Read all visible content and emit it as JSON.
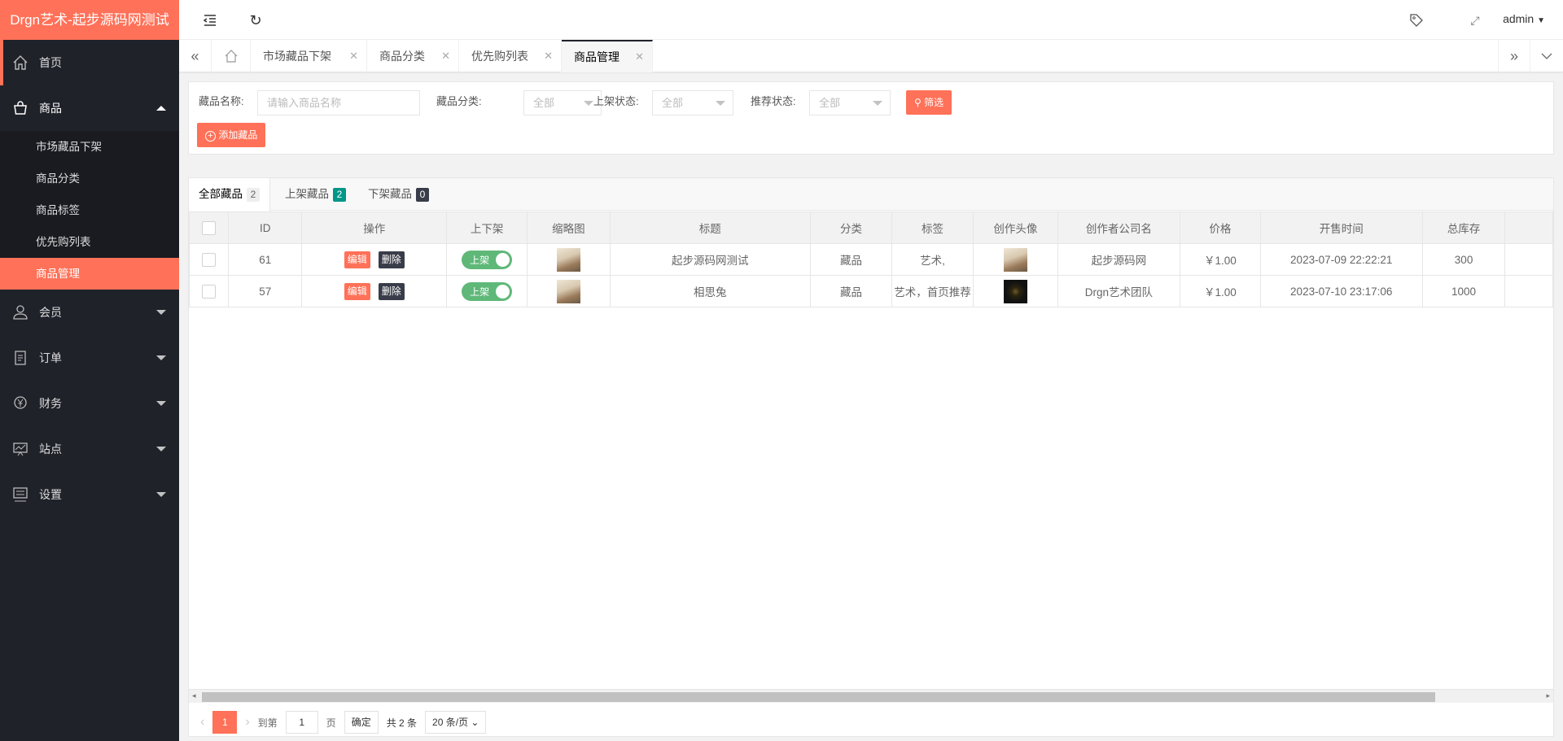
{
  "app": {
    "title": "Drgn艺术-起步源码网测试",
    "user": "admin"
  },
  "sidebar": {
    "items": [
      {
        "label": "首页",
        "icon": "home-icon"
      },
      {
        "label": "商品",
        "icon": "basket-icon",
        "open": true,
        "children": [
          {
            "label": "市场藏品下架"
          },
          {
            "label": "商品分类"
          },
          {
            "label": "商品标签"
          },
          {
            "label": "优先购列表"
          },
          {
            "label": "商品管理",
            "active": true
          }
        ]
      },
      {
        "label": "会员",
        "icon": "user-icon"
      },
      {
        "label": "订单",
        "icon": "order-icon"
      },
      {
        "label": "财务",
        "icon": "finance-icon"
      },
      {
        "label": "站点",
        "icon": "site-icon"
      },
      {
        "label": "设置",
        "icon": "settings-icon"
      }
    ]
  },
  "tabs": [
    {
      "label": "市场藏品下架"
    },
    {
      "label": "商品分类"
    },
    {
      "label": "优先购列表"
    },
    {
      "label": "商品管理",
      "active": true
    }
  ],
  "filter": {
    "name_label": "藏品名称:",
    "name_placeholder": "请输入商品名称",
    "category_label": "藏品分类:",
    "category_value": "全部",
    "shelf_label": "上架状态:",
    "shelf_value": "全部",
    "recommend_label": "推荐状态:",
    "recommend_value": "全部",
    "search_button": "筛选",
    "add_button": "添加藏品"
  },
  "list_tabs": [
    {
      "label": "全部藏品",
      "count": "2"
    },
    {
      "label": "上架藏品",
      "count": "2"
    },
    {
      "label": "下架藏品",
      "count": "0"
    }
  ],
  "table": {
    "columns": [
      "ID",
      "操作",
      "上下架",
      "缩略图",
      "标题",
      "分类",
      "标签",
      "创作头像",
      "创作者公司名",
      "价格",
      "开售时间",
      "总库存"
    ],
    "edit_label": "编辑",
    "delete_label": "删除",
    "toggle_label": "上架",
    "rows": [
      {
        "id": "61",
        "title": "起步源码网测试",
        "category": "藏品",
        "tags": "艺术,",
        "company": "起步源码网",
        "price": "￥1.00",
        "sale_time": "2023-07-09 22:22:21",
        "stock": "300"
      },
      {
        "id": "57",
        "title": "相思兔",
        "category": "藏品",
        "tags": "艺术，首页推荐",
        "company": "Drgn艺术团队",
        "price": "￥1.00",
        "sale_time": "2023-07-10 23:17:06",
        "stock": "1000"
      }
    ]
  },
  "pagination": {
    "current": "1",
    "goto_label": "到第",
    "goto_value": "1",
    "page_label": "页",
    "confirm": "确定",
    "total": "共 2 条",
    "page_size": "20 条/页"
  },
  "colors": {
    "accent": "#ff7158",
    "sidebar": "#20222a",
    "success": "#5fb878",
    "teal": "#009688"
  }
}
